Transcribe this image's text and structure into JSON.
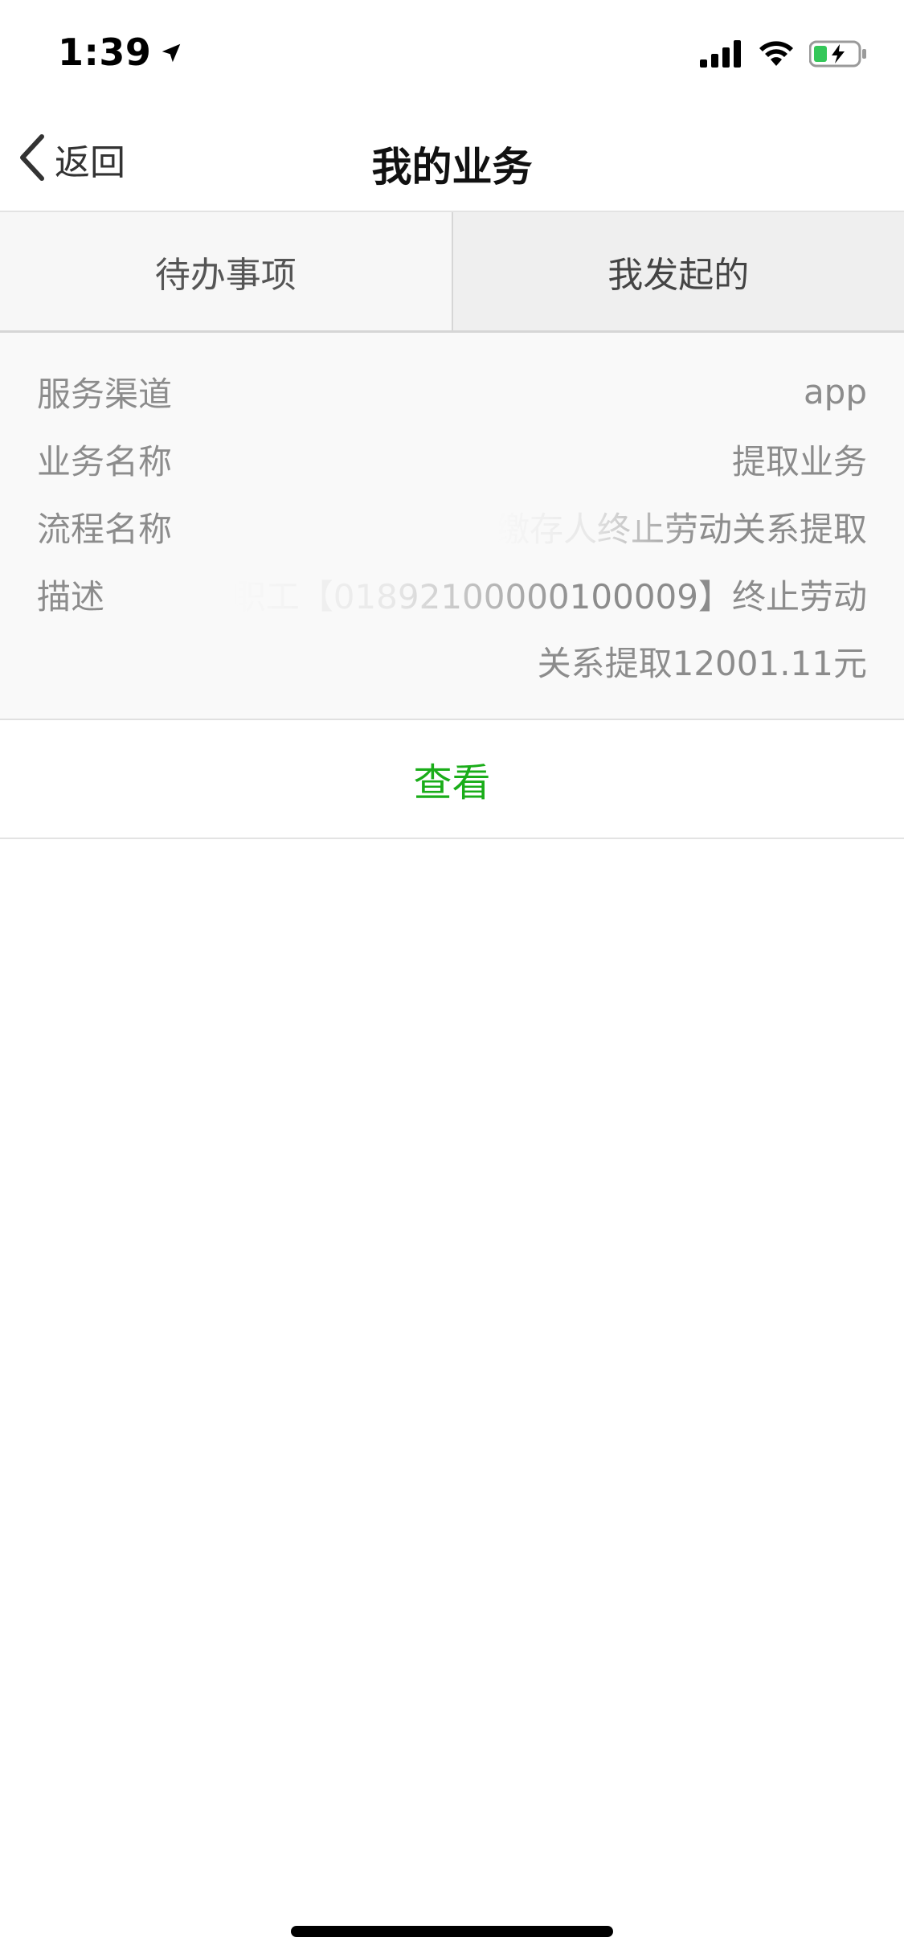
{
  "status_bar": {
    "time": "1:39",
    "icons": [
      "location-arrow-icon",
      "signal-icon",
      "wifi-icon",
      "battery-charging-icon"
    ]
  },
  "nav": {
    "back_label": "返回",
    "title": "我的业务"
  },
  "tabs": [
    {
      "label": "待办事项",
      "active": false
    },
    {
      "label": "我发起的",
      "active": true
    }
  ],
  "card": {
    "rows": [
      {
        "label": "服务渠道",
        "value": "app"
      },
      {
        "label": "业务名称",
        "value": "提取业务"
      },
      {
        "label": "流程名称",
        "value": "缴存人终止劳动关系提取"
      },
      {
        "label": "描述",
        "value": "职工【01892100000100009】终止劳动",
        "value_line2": "关系提取12001.11元"
      }
    ]
  },
  "view_button": {
    "label": "查看"
  },
  "colors": {
    "accent": "#1aad19",
    "card_bg": "#f9f9f9",
    "text_muted": "#8c8c8c"
  }
}
